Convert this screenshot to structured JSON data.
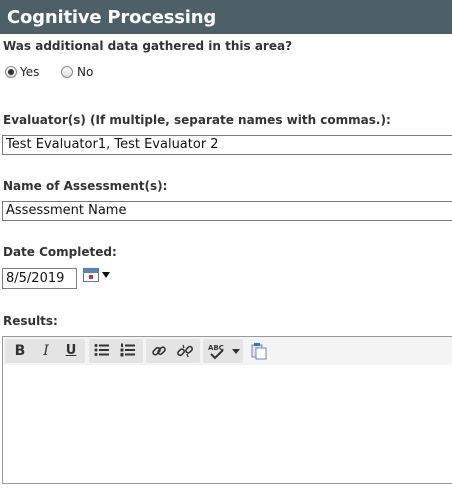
{
  "section": {
    "title": "Cognitive Processing"
  },
  "additional_data": {
    "question": "Was additional data gathered in this area?",
    "options": [
      {
        "label": "Yes",
        "selected": true
      },
      {
        "label": "No",
        "selected": false
      }
    ]
  },
  "evaluators": {
    "label": "Evaluator(s) (If multiple, separate names with commas.):",
    "value": "Test Evaluator1, Test Evaluator 2"
  },
  "assessment": {
    "label": "Name of Assessment(s):",
    "value": "Assessment Name"
  },
  "date_completed": {
    "label": "Date Completed:",
    "value": "8/5/2019",
    "icon": "calendar-icon"
  },
  "results": {
    "label": "Results:",
    "toolbar": {
      "bold": "B",
      "italic": "I",
      "underline": "U",
      "bulleted_list_icon": "bulleted-list-icon",
      "numbered_list_icon": "numbered-list-icon",
      "link_icon": "link-icon",
      "unlink_icon": "unlink-icon",
      "spellcheck_icon": "spellcheck-icon",
      "paste_icon": "paste-icon"
    },
    "content": ""
  },
  "colors": {
    "header_bg": "#4d6068",
    "header_text": "#ffffff"
  }
}
